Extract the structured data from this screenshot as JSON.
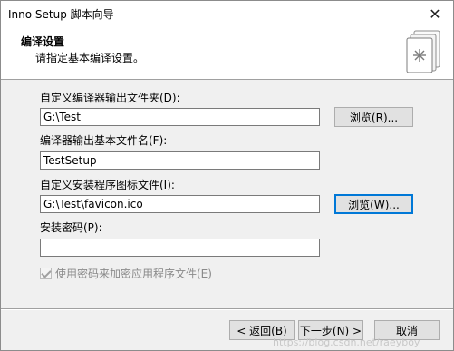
{
  "window": {
    "title": "Inno Setup 脚本向导",
    "close_glyph": "✕"
  },
  "header": {
    "title": "编译设置",
    "subtitle": "请指定基本编译设置。"
  },
  "form": {
    "output_folder_label": "自定义编译器输出文件夹(D):",
    "output_folder_value": "G:\\Test",
    "browse1_label": "浏览(R)...",
    "base_name_label": "编译器输出基本文件名(F):",
    "base_name_value": "TestSetup",
    "icon_file_label": "自定义安装程序图标文件(I):",
    "icon_file_value": "G:\\Test\\favicon.ico",
    "browse2_label": "浏览(W)...",
    "password_label": "安装密码(P):",
    "password_value": "",
    "encrypt_label": "使用密码来加密应用程序文件(E)",
    "encrypt_checked": true
  },
  "footer": {
    "back_label": "< 返回(B)",
    "next_label": "下一步(N) >",
    "cancel_label": "取消"
  },
  "watermark": "https://blog.csdn.net/raeyboy"
}
